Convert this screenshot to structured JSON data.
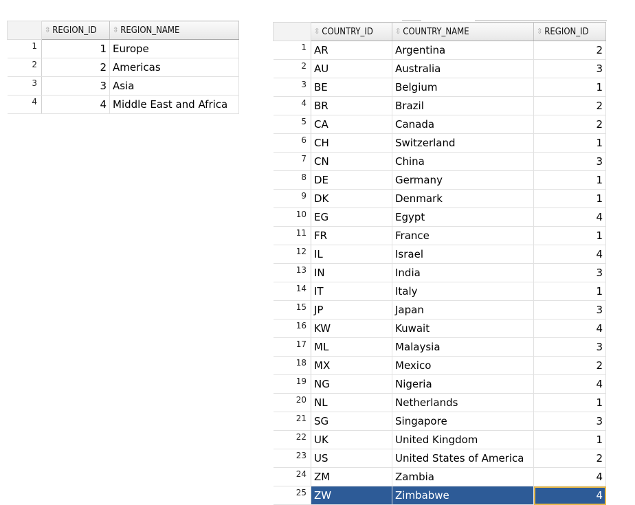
{
  "regions_grid": {
    "columns": [
      "REGION_ID",
      "REGION_NAME"
    ],
    "rows": [
      {
        "rownum": "1",
        "region_id": "1",
        "region_name": "Europe"
      },
      {
        "rownum": "2",
        "region_id": "2",
        "region_name": "Americas"
      },
      {
        "rownum": "3",
        "region_id": "3",
        "region_name": "Asia"
      },
      {
        "rownum": "4",
        "region_id": "4",
        "region_name": "Middle East and Africa"
      }
    ]
  },
  "countries_grid": {
    "columns": [
      "COUNTRY_ID",
      "COUNTRY_NAME",
      "REGION_ID"
    ],
    "rows": [
      {
        "rownum": "1",
        "country_id": "AR",
        "country_name": "Argentina",
        "region_id": "2"
      },
      {
        "rownum": "2",
        "country_id": "AU",
        "country_name": "Australia",
        "region_id": "3"
      },
      {
        "rownum": "3",
        "country_id": "BE",
        "country_name": "Belgium",
        "region_id": "1"
      },
      {
        "rownum": "4",
        "country_id": "BR",
        "country_name": "Brazil",
        "region_id": "2"
      },
      {
        "rownum": "5",
        "country_id": "CA",
        "country_name": "Canada",
        "region_id": "2"
      },
      {
        "rownum": "6",
        "country_id": "CH",
        "country_name": "Switzerland",
        "region_id": "1"
      },
      {
        "rownum": "7",
        "country_id": "CN",
        "country_name": "China",
        "region_id": "3"
      },
      {
        "rownum": "8",
        "country_id": "DE",
        "country_name": "Germany",
        "region_id": "1"
      },
      {
        "rownum": "9",
        "country_id": "DK",
        "country_name": "Denmark",
        "region_id": "1"
      },
      {
        "rownum": "10",
        "country_id": "EG",
        "country_name": "Egypt",
        "region_id": "4"
      },
      {
        "rownum": "11",
        "country_id": "FR",
        "country_name": "France",
        "region_id": "1"
      },
      {
        "rownum": "12",
        "country_id": "IL",
        "country_name": "Israel",
        "region_id": "4"
      },
      {
        "rownum": "13",
        "country_id": "IN",
        "country_name": "India",
        "region_id": "3"
      },
      {
        "rownum": "14",
        "country_id": "IT",
        "country_name": "Italy",
        "region_id": "1"
      },
      {
        "rownum": "15",
        "country_id": "JP",
        "country_name": "Japan",
        "region_id": "3"
      },
      {
        "rownum": "16",
        "country_id": "KW",
        "country_name": "Kuwait",
        "region_id": "4"
      },
      {
        "rownum": "17",
        "country_id": "ML",
        "country_name": "Malaysia",
        "region_id": "3"
      },
      {
        "rownum": "18",
        "country_id": "MX",
        "country_name": "Mexico",
        "region_id": "2"
      },
      {
        "rownum": "19",
        "country_id": "NG",
        "country_name": "Nigeria",
        "region_id": "4"
      },
      {
        "rownum": "20",
        "country_id": "NL",
        "country_name": "Netherlands",
        "region_id": "1"
      },
      {
        "rownum": "21",
        "country_id": "SG",
        "country_name": "Singapore",
        "region_id": "3"
      },
      {
        "rownum": "22",
        "country_id": "UK",
        "country_name": "United Kingdom",
        "region_id": "1"
      },
      {
        "rownum": "23",
        "country_id": "US",
        "country_name": "United States of America",
        "region_id": "2"
      },
      {
        "rownum": "24",
        "country_id": "ZM",
        "country_name": "Zambia",
        "region_id": "4"
      },
      {
        "rownum": "25",
        "country_id": "ZW",
        "country_name": "Zimbabwe",
        "region_id": "4"
      }
    ],
    "selected_row": 25
  },
  "icons": {
    "sort": "sort-arrows-icon"
  },
  "colors": {
    "selection": "#2d5b97",
    "focus_outline": "#e7b94a"
  }
}
